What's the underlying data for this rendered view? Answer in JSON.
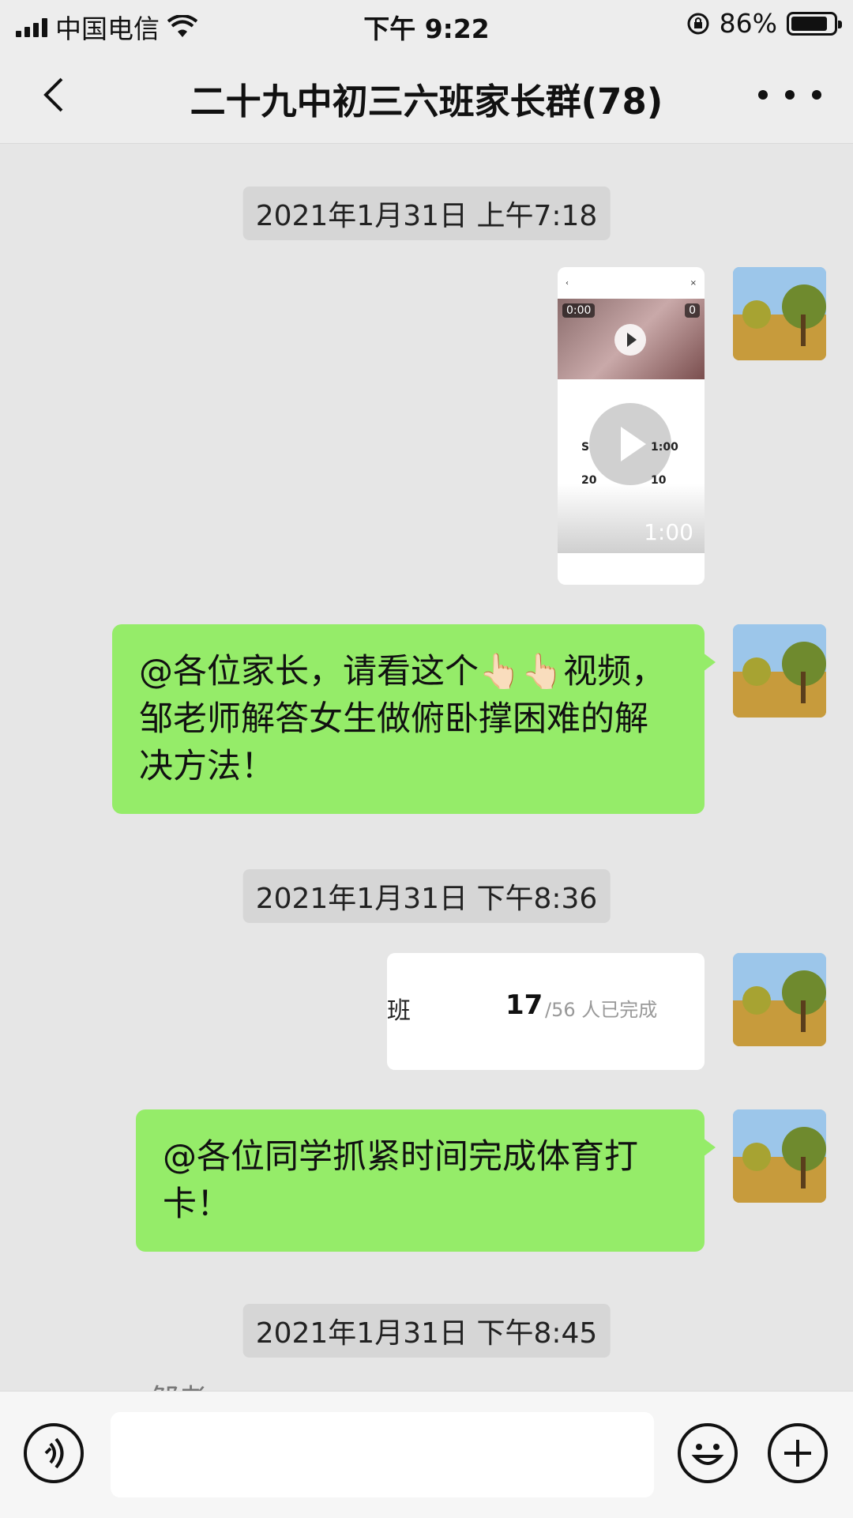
{
  "status_bar": {
    "carrier": "中国电信",
    "time": "下午 9:22",
    "battery": "86%",
    "battery_level": 0.86
  },
  "nav": {
    "title": "二十九中初三六班家长群(78)"
  },
  "messages": [
    {
      "type": "timestamp",
      "text": "2021年1月31日 上午7:18"
    },
    {
      "type": "video",
      "badge_left": "0:00",
      "badge_right": "0",
      "stats": [
        "S",
        "1:00",
        "20",
        "10"
      ],
      "duration": "1:00"
    },
    {
      "type": "text",
      "text": "@各位家长，请看这个👆🏻👆🏻视频，邹老师解答女生做俯卧撑困难的解决方法！"
    },
    {
      "type": "timestamp",
      "text": "2021年1月31日 下午8:36"
    },
    {
      "type": "checkin",
      "class_text": "班",
      "count": "17",
      "total_text": "/56 人已完成"
    },
    {
      "type": "text",
      "text": "@各位同学抓紧时间完成体育打卡！"
    },
    {
      "type": "timestamp",
      "text": "2021年1月31日 下午8:45"
    }
  ],
  "partial_text": "邹老",
  "colors": {
    "bubble_green": "#95ec69",
    "chat_bg": "#e6e6e6",
    "bar_bg": "#ededed"
  }
}
